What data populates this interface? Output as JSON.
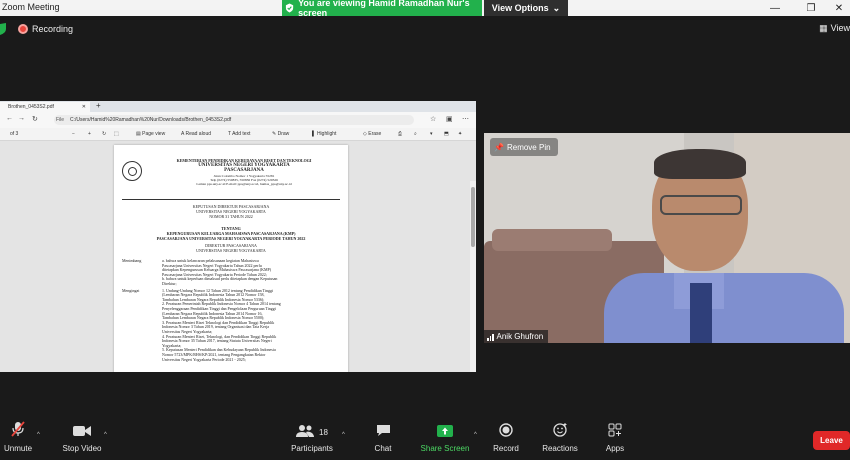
{
  "window": {
    "title": "Zoom Meeting",
    "share_banner": "You are viewing Hamid Ramadhan Nur's screen",
    "view_options": "View Options"
  },
  "topbar": {
    "recording": "Recording",
    "view": "View"
  },
  "browser": {
    "tab_title": "Brothen_0453S2.pdf",
    "url_scheme": "File",
    "url": "C:/Users/Hamid%20Ramadhan%20Nur/Downloads/Brothen_0453S2.pdf",
    "page_counter": "of 3",
    "toolbar": {
      "page_view": "Page view",
      "read_aloud": "Read aloud",
      "add_text": "Add text",
      "draw": "Draw",
      "highlight": "Highlight",
      "erase": "Erase"
    }
  },
  "pdf": {
    "letterhead": [
      "KEMENTERIAN PENDIDIKAN KEBUDAYAAN RISET DAN TEKNOLOGI",
      "UNIVERSITAS NEGERI YOGYAKARTA",
      "PASCASARJANA",
      "Jalan Colombo Nomor 1 Yogyakarta 55281",
      "Telp (0274) 550835, 550836 Fax (0274) 520326",
      "Laman pps.uny.ac.id E-mail: pps@uny.ac.id, humas_pps@uny.ac.id"
    ],
    "decree": [
      "KEPUTUSAN DIREKTUR PASCASARJANA",
      "UNIVERSITAS NEGERI YOGYAKARTA",
      "NOMOR 31 TAHUN 2022"
    ],
    "subject": [
      "TENTANG",
      "KEPENGURUSAN KELUARGA MAHASISWA PASCASARJANA (KMP)",
      "PASCASARJANA UNIVERSITAS NEGERI YOGYAKARTA PERIODE TAHUN 2022"
    ],
    "director": [
      "DIREKTUR PASCASARJANA",
      "UNIVERSITAS NEGERI YOGYAKARTA"
    ],
    "menimbang_label": "Menimbang",
    "mengingat_label": "Mengingat",
    "menimbang_lines": [
      "a. bahwa untuk kelancaran pelaksanaan kegiatan Mahasiswa",
      "   Pascasarjana Universitas Negeri Yogyakarta Tahun 2022 perlu",
      "   ditetapkan Kepengurusan Keluarga Mahasiswa Pascasarjana (KMP)",
      "   Pascasarjana Universitas Negeri Yogyakarta Periode Tahun 2022;",
      "b. bahwa untuk keperluan dimaksud perlu ditetapkan dengan Keputusan",
      "   Direktur;"
    ],
    "mengingat_lines": [
      "1. Undang-Undang Nomor 12 Tahun 2012 tentang Pendidikan Tinggi",
      "   (Lembaran Negara Republik Indonesia Tahun 2012 Nomor 158,",
      "   Tambahan Lembaran Negara Republik Indonesia Nomor 5336);",
      "2. Peraturan Pemerintah Republik Indonesia Nomor 4 Tahun 2014 tentang",
      "   Penyelenggaraan Pendidikan Tinggi dan Pengelolaan Perguruan Tinggi",
      "   (Lembaran Negara Republik Indonesia Tahun 2014 Nomor 16,",
      "   Tambahan Lembaran Negara Republik Indonesia Nomor 5500);",
      "3. Peraturan Menteri Riset Teknologi dan Pendidikan Tinggi Republik",
      "   Indonesia Nomor 3 Tahun 2019, tentang Organisasi dan Tata Kerja",
      "   Universitas Negeri Yogyakarta;",
      "4. Peraturan Menteri Riset, Teknologi, dan Pendidikan Tinggi Republik",
      "   Indonesia Nomor 35 Tahun 2017, tentang Statuta Universitas Negeri",
      "   Yogyakarta;",
      "5. Keputusan Menteri Pendidikan dan Kebudayaan Republik Indonesia",
      "   Nomor 5723/MPK/RHS/KP/2021, tentang Pengangkatan Rektor",
      "   Universitas Negeri Yogyakarta Periode 2021 - 2025;"
    ]
  },
  "video": {
    "remove_pin": "Remove Pin",
    "participant_name": "Anik Ghufron"
  },
  "controls": {
    "unmute": "Unmute",
    "stop_video": "Stop Video",
    "participants": "Participants",
    "participants_count": "18",
    "chat": "Chat",
    "share_screen": "Share Screen",
    "record": "Record",
    "reactions": "Reactions",
    "apps": "Apps",
    "leave": "Leave"
  },
  "colors": {
    "share_green": "#22b14c",
    "leave_red": "#e02828",
    "record_red": "#e8453c"
  }
}
